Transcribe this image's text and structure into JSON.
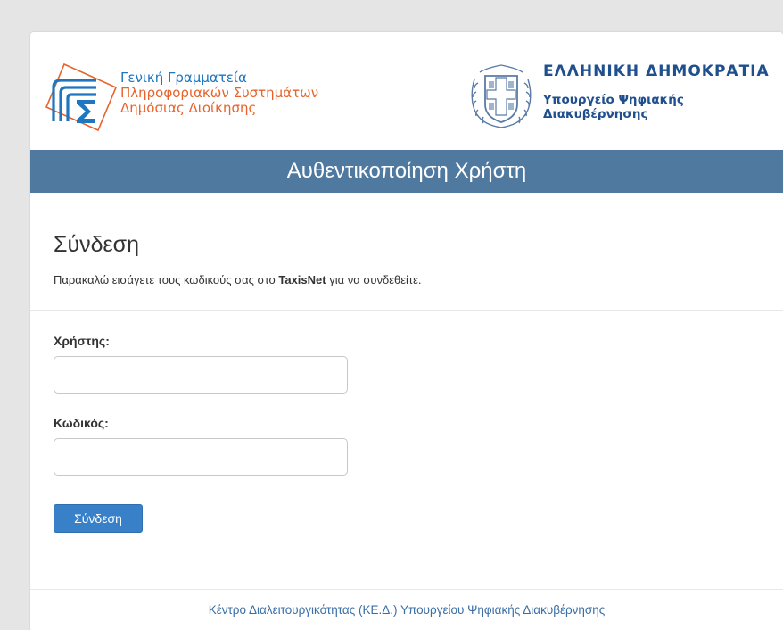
{
  "header": {
    "gsis_lines": [
      "Γενική Γραμματεία",
      "Πληροφοριακών Συστημάτων",
      "Δημόσιας Διοίκησης"
    ],
    "republic_title": "ΕΛΛΗΝΙΚΗ ΔΗΜΟΚΡΑΤΙΑ",
    "ministry_lines": [
      "Υπουργείο Ψηφιακής",
      "Διακυβέρνησης"
    ]
  },
  "banner": {
    "title": "Αυθεντικοποίηση Χρήστη"
  },
  "login": {
    "heading": "Σύνδεση",
    "intro_before": "Παρακαλώ εισάγετε τους κωδικούς σας στο ",
    "intro_strong": "TaxisNet",
    "intro_after": " για να συνδεθείτε.",
    "username_label": "Χρήστης:",
    "username_value": "",
    "password_label": "Κωδικός:",
    "password_value": "",
    "submit_label": "Σύνδεση"
  },
  "footer": {
    "link_text": "Κέντρο Διαλειτουργικότητας (ΚΕ.Δ.) Υπουργείου Ψηφιακής Διακυβέρνησης"
  },
  "colors": {
    "banner": "#5079a0",
    "button": "#3880c8",
    "gsis_blue": "#1e76c0",
    "gsis_orange": "#e8632b",
    "ministry_blue": "#1f4f8c",
    "page_bg": "#e5e5e5"
  },
  "icons": {
    "gsis_logo": "gsis-logo-icon",
    "emblem": "hellenic-republic-emblem-icon"
  }
}
